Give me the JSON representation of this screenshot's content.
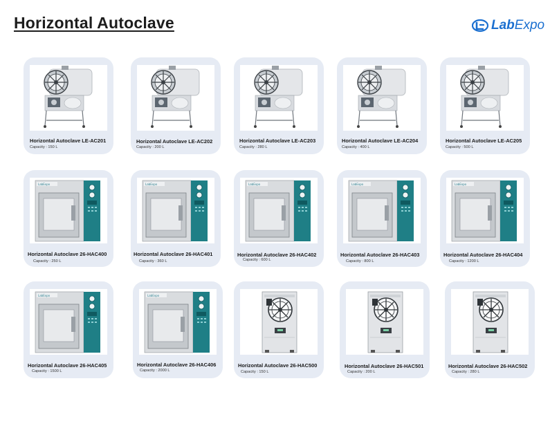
{
  "page": {
    "title": "Horizontal Autoclave"
  },
  "brand": {
    "logo_prefix": "Lab",
    "logo_suffix": "Expo"
  },
  "products": [
    {
      "name": "Horizontal Autoclave LE-AC201",
      "capacity": "Capacity : 150 L",
      "style": "ha"
    },
    {
      "name": "Horizontal Autoclave LE-AC202",
      "capacity": "Capacity : 200 L",
      "style": "ha"
    },
    {
      "name": "Horizontal Autoclave LE-AC203",
      "capacity": "Capacity : 280 L",
      "style": "ha"
    },
    {
      "name": "Horizontal Autoclave LE-AC204",
      "capacity": "Capacity : 400 L",
      "style": "ha"
    },
    {
      "name": "Horizontal Autoclave LE-AC205",
      "capacity": "Capacity : 500 L",
      "style": "ha"
    },
    {
      "name": "Horizontal Autoclave 26-HAC400",
      "capacity": "Capacity : 250 L",
      "style": "fl"
    },
    {
      "name": "Horizontal Autoclave 26-HAC401",
      "capacity": "Capacity : 360 L",
      "style": "fl"
    },
    {
      "name": "Horizontal Autoclave 26-HAC402",
      "capacity": "Capacity : 600 L",
      "style": "fl"
    },
    {
      "name": "Horizontal Autoclave 26-HAC403",
      "capacity": "Capacity :  800 L",
      "style": "fl"
    },
    {
      "name": "Horizontal Autoclave 26-HAC404",
      "capacity": "Capacity : 1200 L",
      "style": "fl"
    },
    {
      "name": "Horizontal Autoclave 26-HAC405",
      "capacity": "Capacity : 1500 L",
      "style": "fl"
    },
    {
      "name": "Horizontal Autoclave 26-HAC406",
      "capacity": "Capacity : 2000 L",
      "style": "fl"
    },
    {
      "name": "Horizontal Autoclave 26-HAC500",
      "capacity": "Capacity : 150 L",
      "style": "vc"
    },
    {
      "name": "Horizontal Autoclave 26-HAC501",
      "capacity": "Capacity : 200 L",
      "style": "vc"
    },
    {
      "name": "Horizontal Autoclave 26-HAC502",
      "capacity": "Capacity : 280 L",
      "style": "vc"
    }
  ]
}
